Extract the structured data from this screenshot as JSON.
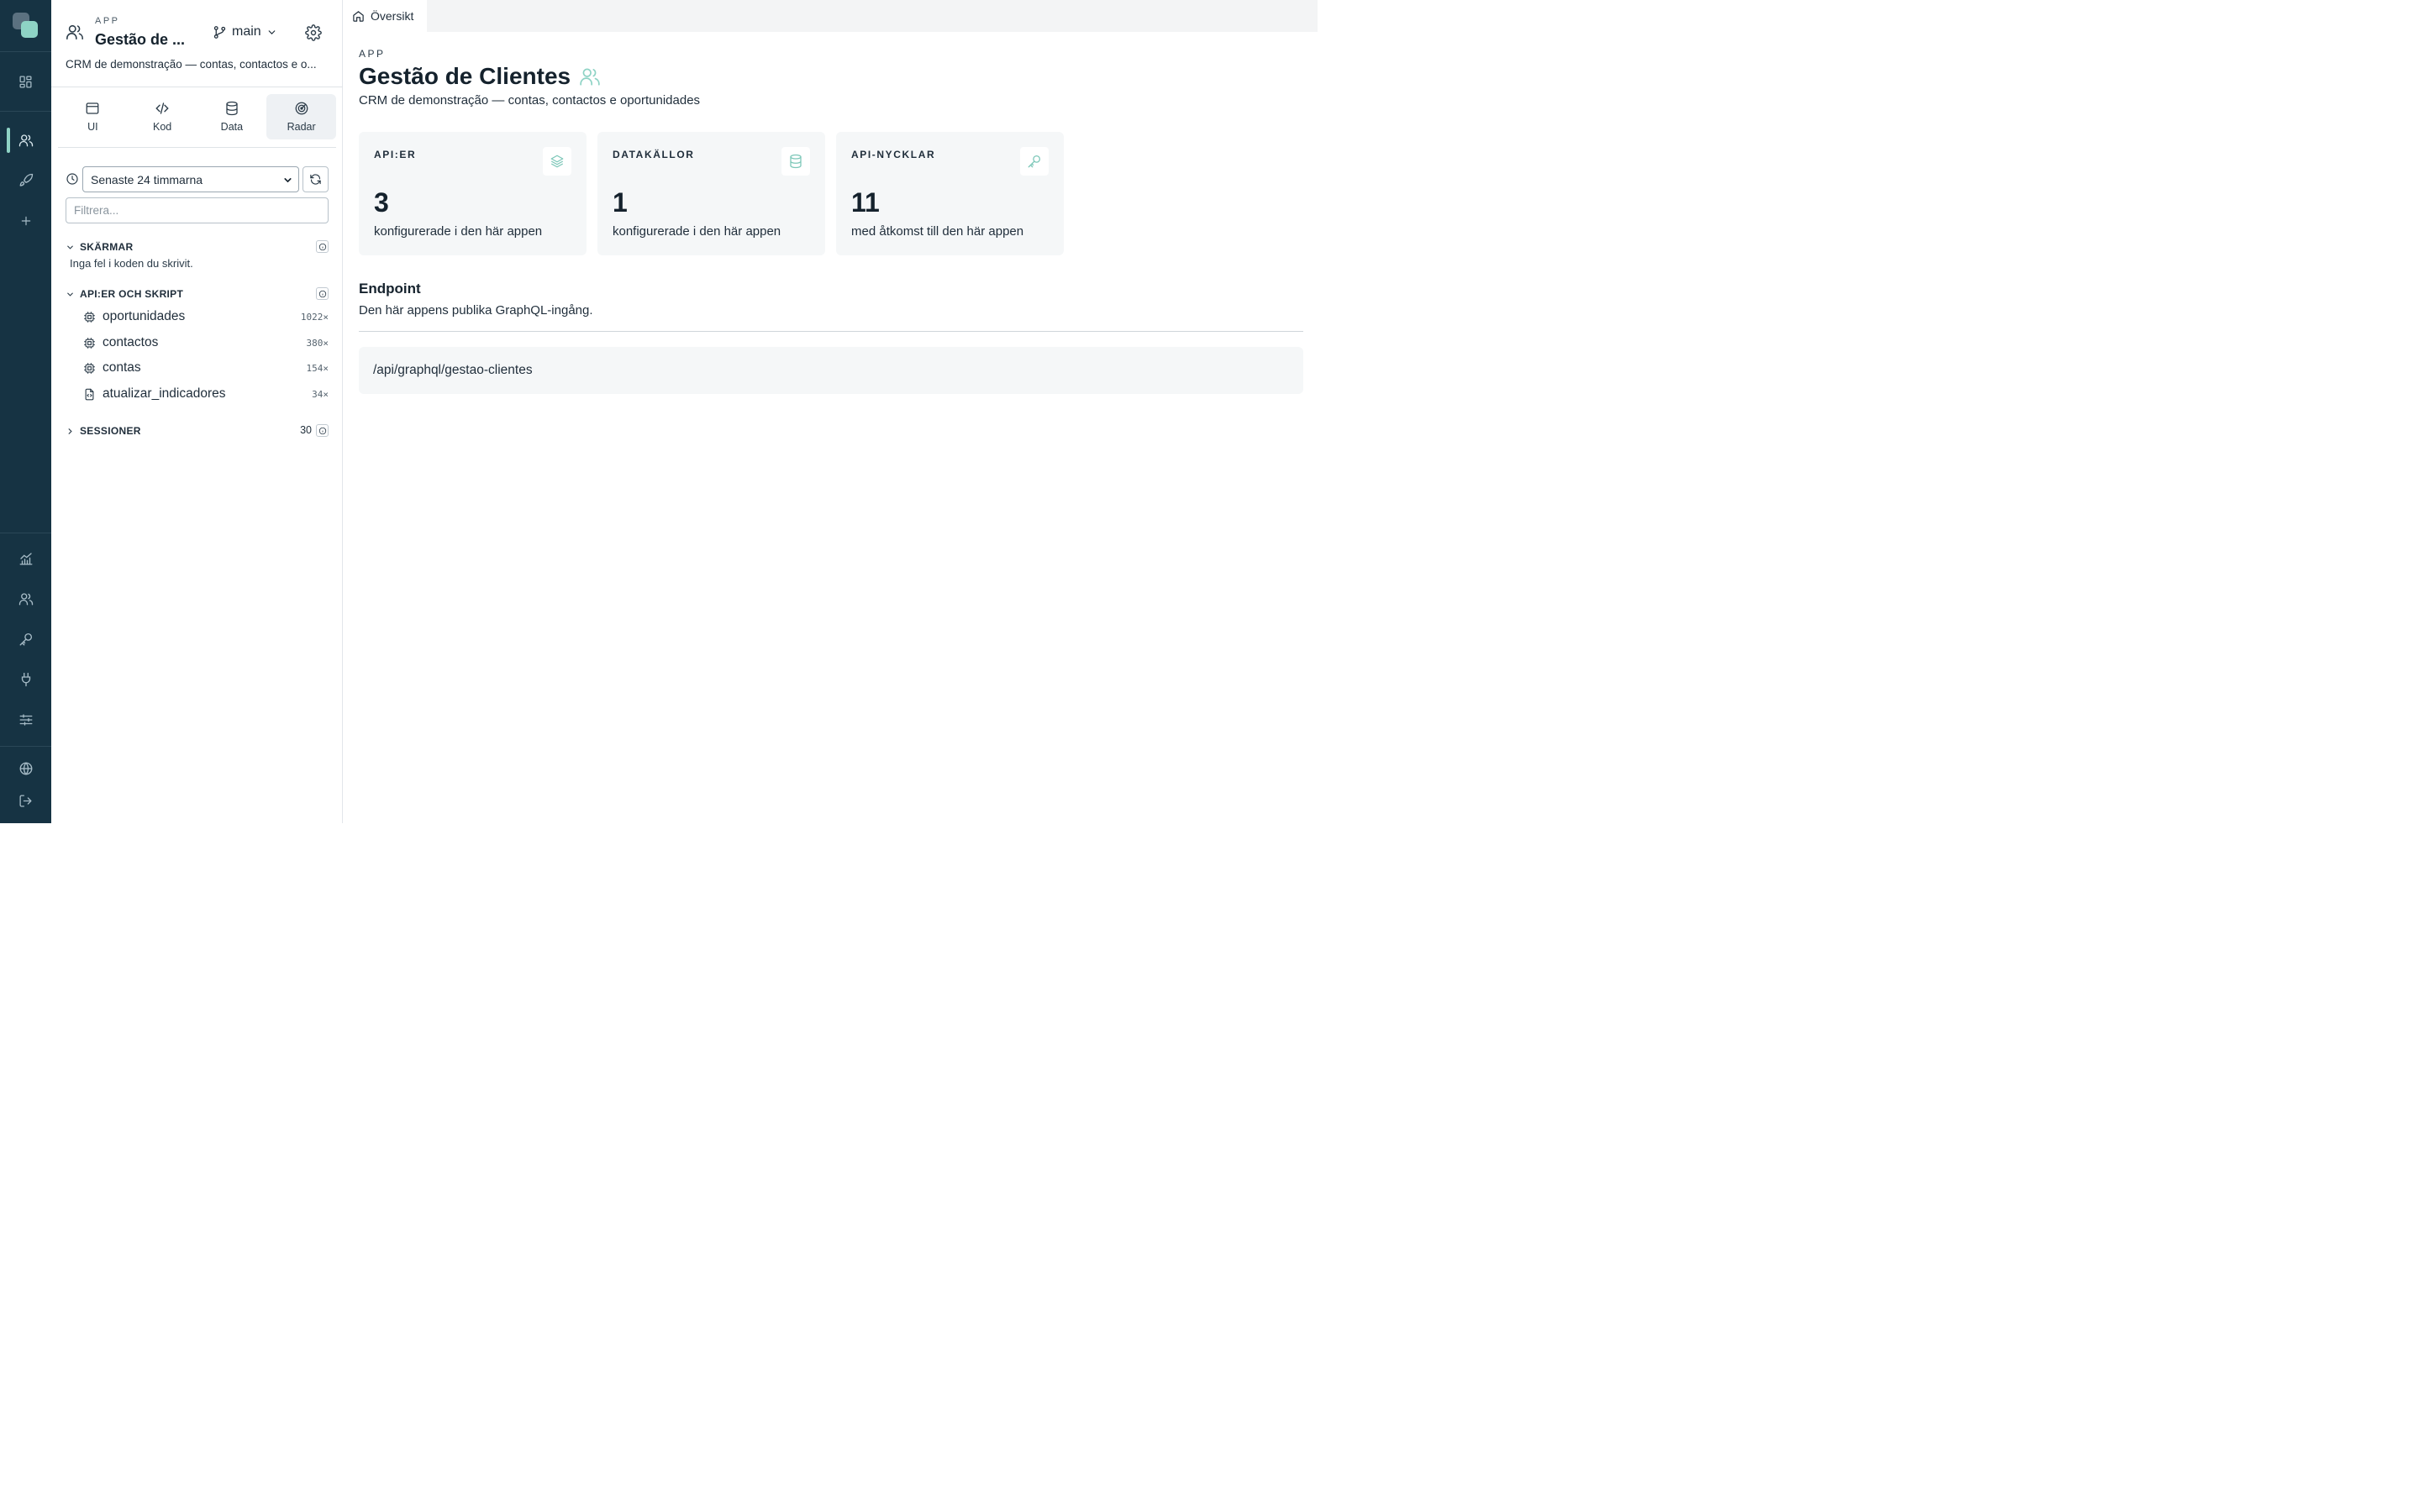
{
  "rail": {
    "icons": [
      "dashboard-icon",
      "users-icon",
      "rocket-icon",
      "plus-icon",
      "chart-icon",
      "team-icon",
      "key-icon",
      "plug-icon",
      "sliders-icon",
      "globe-icon",
      "logout-icon"
    ],
    "active": "users-icon"
  },
  "panel": {
    "kicker": "APP",
    "title": "Gestão de ...",
    "branch": "main",
    "description": "CRM de demonstração — contas, contactos e o...",
    "tabs": [
      {
        "label": "UI",
        "icon": "window-icon"
      },
      {
        "label": "Kod",
        "icon": "code-icon"
      },
      {
        "label": "Data",
        "icon": "database-icon"
      },
      {
        "label": "Radar",
        "icon": "radar-icon"
      }
    ],
    "active_tab": "Radar",
    "time_range": "Senaste 24 timmarna",
    "filter_placeholder": "Filtrera...",
    "sections": {
      "screens": {
        "label": "SKÄRMAR",
        "note": "Inga fel i koden du skrivit."
      },
      "apis": {
        "label": "API:ER OCH SKRIPT",
        "items": [
          {
            "name": "oportunidades",
            "calls": "1022×",
            "icon": "cpu-icon"
          },
          {
            "name": "contactos",
            "calls": "380×",
            "icon": "cpu-icon"
          },
          {
            "name": "contas",
            "calls": "154×",
            "icon": "cpu-icon"
          },
          {
            "name": "atualizar_indicadores",
            "calls": "34×",
            "icon": "script-file-icon"
          }
        ]
      },
      "sessions": {
        "label": "SESSIONER",
        "count": "30"
      }
    }
  },
  "main": {
    "tab_label": "Översikt",
    "kicker": "APP",
    "title": "Gestão de Clientes",
    "description": "CRM de demonstração — contas, contactos e oportunidades",
    "cards": [
      {
        "label": "API:ER",
        "value": "3",
        "sub": "konfigurerade i den här appen",
        "icon": "layers-icon"
      },
      {
        "label": "DATAKÄLLOR",
        "value": "1",
        "sub": "konfigurerade i den här appen",
        "icon": "database-icon"
      },
      {
        "label": "API-NYCKLAR",
        "value": "11",
        "sub": "med åtkomst till den här appen",
        "icon": "key-icon"
      }
    ],
    "endpoint": {
      "title": "Endpoint",
      "description": "Den här appens publika GraphQL-ingång.",
      "path": "/api/graphql/gestao-clientes"
    }
  },
  "colors": {
    "rail_bg": "#163343",
    "accent": "#8ed3c5",
    "card_bg": "#f5f7f8"
  }
}
